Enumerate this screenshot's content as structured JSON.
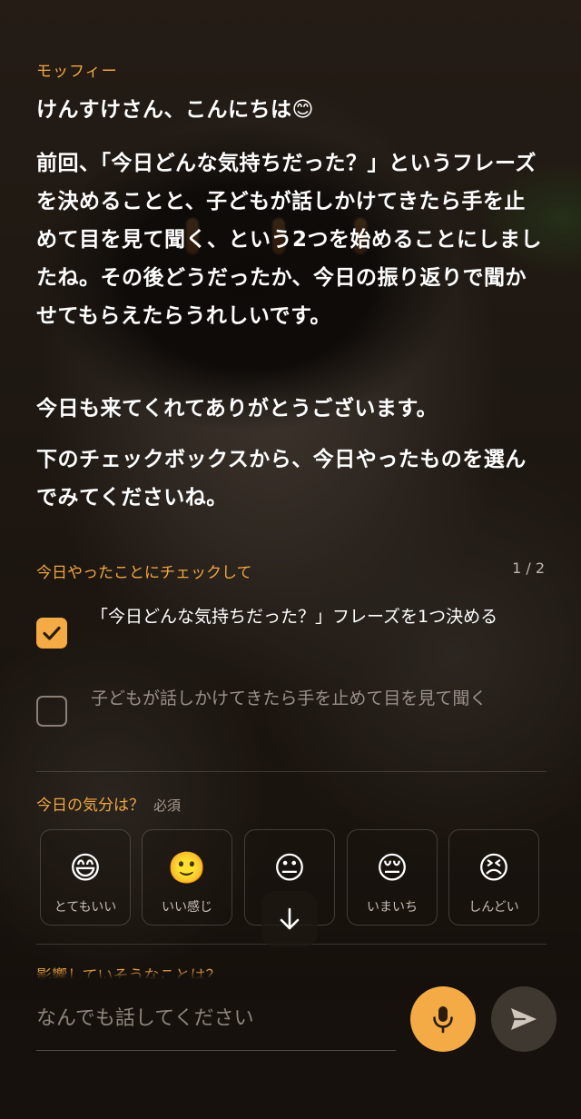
{
  "assistant": {
    "name": "モッフィー"
  },
  "messages": [
    "けんすけさん、こんにちは😊",
    "前回、「今日どんな気持ちだった？」というフレーズを決めることと、子どもが話しかけてきたら手を止めて目を見て聞く、という2つを始めることにしましたね。その後どうだったか、今日の振り返りで聞かせてもらえたらうれしいです。",
    "今日も来てくれてありがとうございます。",
    "下のチェックボックスから、今日やったものを選んでみてくださいね。"
  ],
  "checklist": {
    "title": "今日やったことにチェックして",
    "counter": "1 / 2",
    "items": [
      {
        "label": "「今日どんな気持ちだった？」フレーズを1つ決める",
        "checked": true
      },
      {
        "label": "子どもが話しかけてきたら手を止めて目を見て聞く",
        "checked": false
      }
    ]
  },
  "mood": {
    "title": "今日の気分は？",
    "required": "必須",
    "options": [
      {
        "emoji": "😄",
        "label": "とてもいい"
      },
      {
        "emoji": "🙂",
        "label": "いい感じ"
      },
      {
        "emoji": "😐",
        "label": ""
      },
      {
        "emoji": "😔",
        "label": "いまいち"
      },
      {
        "emoji": "😣",
        "label": "しんどい"
      }
    ]
  },
  "next_question": "影響していそうなことは？",
  "composer": {
    "placeholder": "なんでも話してください"
  },
  "colors": {
    "accent": "#f5ab45",
    "accent_text": "#f0a742"
  },
  "icons": {
    "scroll": "arrow-down-icon",
    "mic": "microphone-icon",
    "send": "send-icon",
    "check": "checkmark-icon"
  }
}
